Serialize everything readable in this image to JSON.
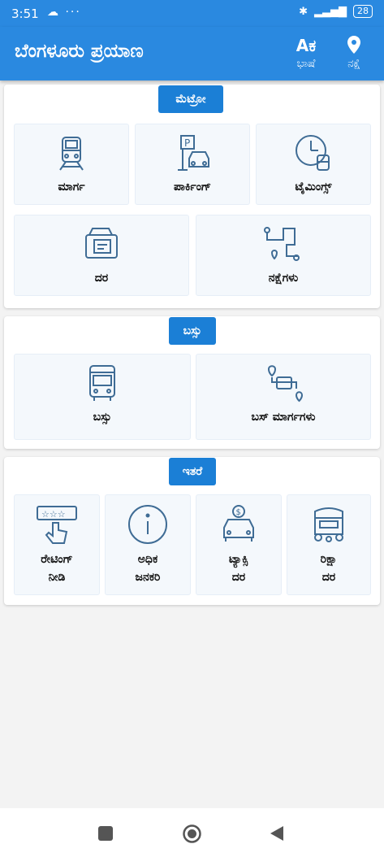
{
  "status_bar": {
    "time": "3:51",
    "battery": "28"
  },
  "app_bar": {
    "title": "ಬೆಂಗಳೂರು ಪ್ರಯಾಣ",
    "language_icon": "Aಕ",
    "language_label": "ಭಾಷೆ",
    "map_label": "ನಕ್ಷೆ"
  },
  "sections": {
    "metro": {
      "title": "ಮೆಟ್ರೋ",
      "tiles": [
        "ಮಾರ್ಗ",
        "ಪಾರ್ಕಿಂಗ್",
        "ಟೈಮಿಂಗ್ಸ್",
        "ದರ",
        "ನಕ್ಷೆಗಳು"
      ]
    },
    "bus": {
      "title": "ಬಸ್ಸು",
      "tiles": [
        "ಬಸ್ಸು",
        "ಬಸ್ ಮಾರ್ಗಗಳು"
      ]
    },
    "others": {
      "title": "ಇತರೆ",
      "tiles": [
        "ರೇಟಿಂಗ್\nನೀಡಿ",
        "ಅಧಿಕ\nಜನಕರಿ",
        "ಟ್ಯಾಕ್ಸಿ\nದರ",
        "ರಿಕ್ಷಾ\nದರ"
      ]
    }
  },
  "icons": {
    "train": "train-icon",
    "parking": "parking-icon",
    "clock": "clock-icon",
    "ticket": "ticket-icon",
    "map": "map-route-icon",
    "bus": "bus-icon",
    "bus_route": "bus-route-icon",
    "rating": "rating-icon",
    "info": "info-icon",
    "taxi": "taxi-icon",
    "rickshaw": "rickshaw-icon"
  },
  "colors": {
    "primary": "#2a89e0",
    "pill": "#1b7fd6",
    "icon": "#3f6c95"
  }
}
